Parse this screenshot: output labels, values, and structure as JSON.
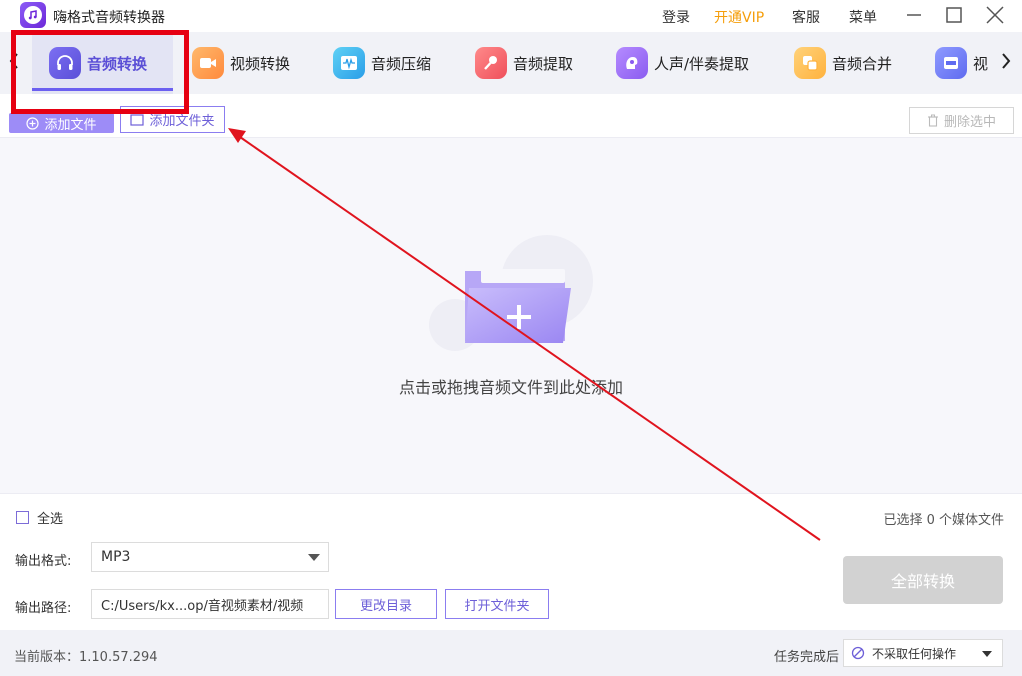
{
  "app": {
    "title": "嗨格式音频转换器",
    "menu": {
      "login": "登录",
      "vip": "开通VIP",
      "service": "客服",
      "menu": "菜单"
    }
  },
  "tabs": [
    {
      "label": "音频转换",
      "icon": "headphones-icon",
      "active": true
    },
    {
      "label": "视频转换",
      "icon": "video-camera-icon"
    },
    {
      "label": "音频压缩",
      "icon": "waveform-icon"
    },
    {
      "label": "音频提取",
      "icon": "microphone-icon"
    },
    {
      "label": "人声/伴奏提取",
      "icon": "voice-icon"
    },
    {
      "label": "音频合并",
      "icon": "merge-icon"
    },
    {
      "label": "视",
      "icon": "gif-icon"
    }
  ],
  "toolbar": {
    "add_file": "添加文件",
    "add_folder": "添加文件夹",
    "delete_selected": "删除选中"
  },
  "drop": {
    "hint": "点击或拖拽音频文件到此处添加"
  },
  "list": {
    "select_all": "全选",
    "selected_count": "已选择 0 个媒体文件"
  },
  "settings": {
    "format_label": "输出格式:",
    "format_value": "MP3",
    "path_label": "输出路径:",
    "path_value": "C:/Users/kx...op/音视频素材/视频",
    "change_dir": "更改目录",
    "open_folder": "打开文件夹",
    "convert_all": "全部转换"
  },
  "status": {
    "version": "当前版本：1.10.57.294",
    "after_label": "任务完成后",
    "after_value": "不采取任何操作"
  },
  "colors": {
    "accent": "#6b5ff0",
    "vip": "#f59e0b",
    "highlight": "#e60012"
  }
}
